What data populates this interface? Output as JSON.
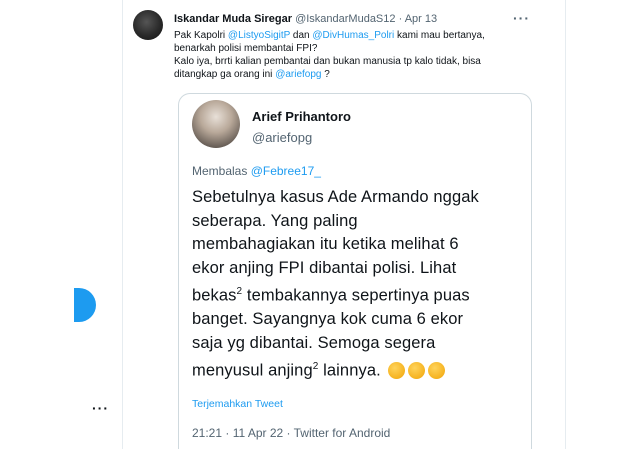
{
  "tweet": {
    "display_name": "Iskandar Muda Siregar",
    "handle": "@IskandarMudaS12",
    "separator": "·",
    "date": "Apr 13",
    "more_label": "···",
    "text": {
      "p1_a": "Pak Kapolri ",
      "mention1": "@ListyoSigitP",
      "p1_b": " dan ",
      "mention2": "@DivHumas_Polri",
      "p1_c": " kami mau bertanya,",
      "line2": "benarkah polisi membantai FPI?",
      "line3": "Kalo iya, brrti kalian pembantai dan bukan manusia tp kalo tidak, bisa",
      "line4_a": "ditangkap ga orang ini ",
      "mention3": "@ariefopg",
      "line4_b": " ?"
    }
  },
  "quote": {
    "display_name": "Arief Prihantoro",
    "handle": "@ariefopg",
    "reply_prefix": "Membalas ",
    "reply_mention": "@Febree17_",
    "body_lines": [
      "Sebetulnya kasus Ade Armando nggak",
      "seberapa. Yang paling",
      "membahagiakan itu ketika melihat 6",
      "ekor anjing FPI dibantai polisi.  Lihat",
      "tembakannya sepertinya puas",
      "banget. Sayangnya kok cuma 6 ekor",
      "saja yg dibantai. Semoga segera",
      "menyusul anjing",
      "lainnya."
    ],
    "line5_prefix": "bekas",
    "superscript": "2",
    "emoji_icon": "hugging-face-icon",
    "translate_label": "Terjemahkan Tweet",
    "meta": "21:21 · 11 Apr 22 · Twitter for Android"
  },
  "sidebar": {
    "more_label": "···"
  },
  "colors": {
    "accent": "#1d9bf0",
    "secondary_text": "#536471",
    "border": "#cfd9de"
  }
}
